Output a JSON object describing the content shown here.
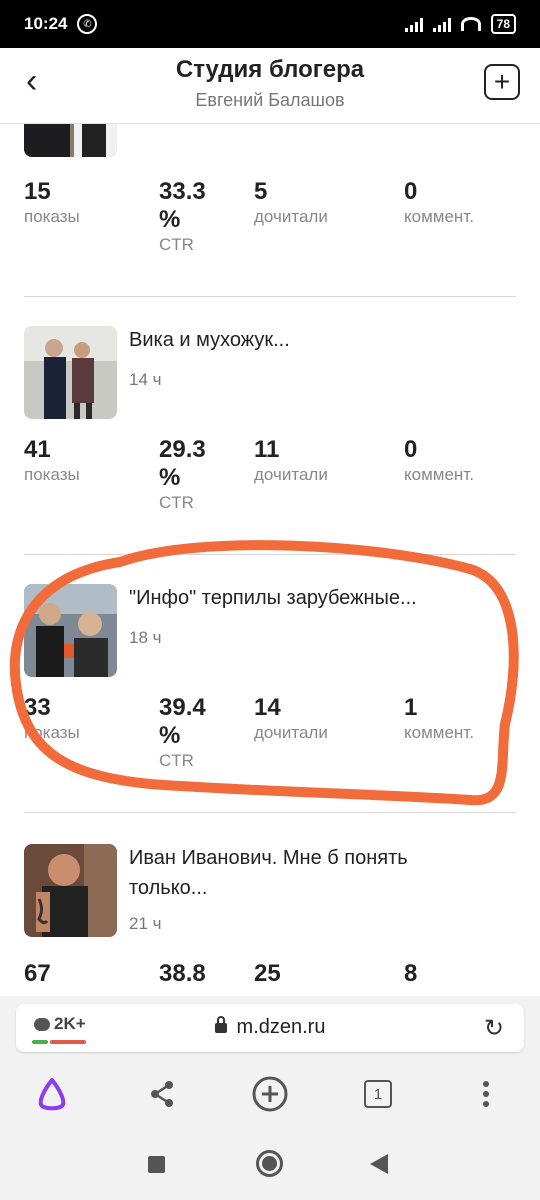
{
  "status_bar": {
    "time": "10:24",
    "battery": "78"
  },
  "header": {
    "title": "Студия блогера",
    "subtitle": "Евгений Балашов"
  },
  "posts": [
    {
      "title_line1": "",
      "title_line2": "",
      "age": "",
      "stats": [
        {
          "value": "15",
          "label": "показы"
        },
        {
          "value": "33.3 %",
          "label": "CTR"
        },
        {
          "value": "5",
          "label": "дочитали"
        },
        {
          "value": "0",
          "label": "коммент."
        }
      ]
    },
    {
      "title_line1": "Вика и мухожук...",
      "title_line2": "",
      "age": "14 ч",
      "stats": [
        {
          "value": "41",
          "label": "показы"
        },
        {
          "value": "29.3 %",
          "label": "CTR"
        },
        {
          "value": "11",
          "label": "дочитали"
        },
        {
          "value": "0",
          "label": "коммент."
        }
      ]
    },
    {
      "title_line1": "\"Инфо\" терпилы зарубежные...",
      "title_line2": "",
      "age": "18 ч",
      "stats": [
        {
          "value": "33",
          "label": "показы"
        },
        {
          "value": "39.4 %",
          "label": "CTR"
        },
        {
          "value": "14",
          "label": "дочитали"
        },
        {
          "value": "1",
          "label": "коммент."
        }
      ]
    },
    {
      "title_line1": "Иван Иванович. Мне б понять",
      "title_line2": "только...",
      "age": "21 ч",
      "stats": [
        {
          "value": "67",
          "label": ""
        },
        {
          "value": "38.8",
          "label": ""
        },
        {
          "value": "25",
          "label": ""
        },
        {
          "value": "8",
          "label": ""
        }
      ]
    }
  ],
  "browser": {
    "tabs_badge": "2K+",
    "url": "m.dzen.ru",
    "tab_count": "1"
  },
  "colors": {
    "highlight": "#f26b3a",
    "alice": "#8a3cf0"
  }
}
